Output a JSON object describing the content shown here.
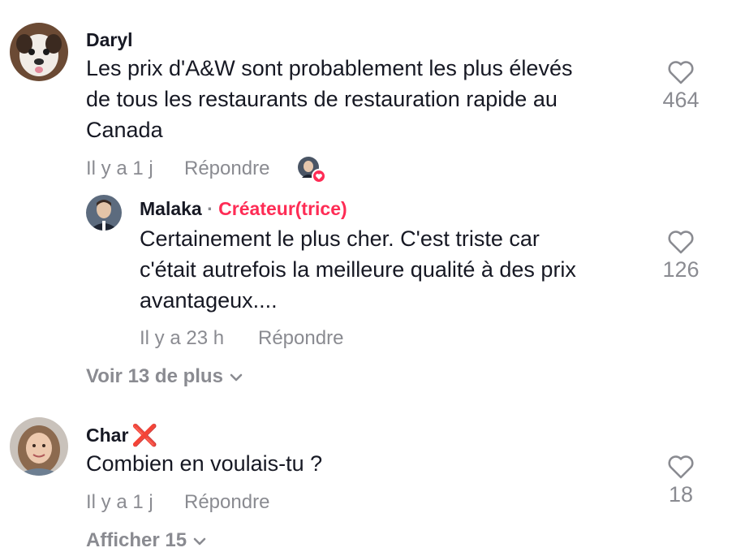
{
  "comments": [
    {
      "username": "Daryl",
      "text": "Les prix d'A&W sont probablement les plus élevés de tous les restaurants de restauration rapide au Canada",
      "lines": [
        "Les prix d'A&W sont probablement les plus élevés",
        "de tous les restaurants de restauration rapide au",
        "Canada"
      ],
      "time": "Il y a 1 j",
      "reply_label": "Répondre",
      "likes": "464",
      "creator_liked": true
    },
    {
      "username": "Malaka",
      "separator": "·",
      "creator_label": "Créateur(trice)",
      "text": "Certainement le plus cher. C'est triste car c'était autrefois la meilleure qualité à des prix avantageux....",
      "lines": [
        "Certainement le plus cher. C'est triste car",
        "c'était autrefois la meilleure qualité à des prix",
        "avantageux...."
      ],
      "time": "Il y a 23 h",
      "reply_label": "Répondre",
      "likes": "126"
    },
    {
      "username": "Char",
      "badge": "❌",
      "text": "Combien en voulais-tu ?",
      "lines": [
        "Combien en voulais-tu ?"
      ],
      "time": "Il y a 1 j",
      "reply_label": "Répondre",
      "likes": "18"
    }
  ],
  "view_more_replies": "Voir 13 de plus",
  "show_more_partial": "Afficher 15",
  "icons": {
    "like": "heart-outline-icon",
    "expand": "chevron-down-icon",
    "creator_like_badge": "heart-badge-icon"
  },
  "colors": {
    "creator_accent": "#fe2c55",
    "muted_text": "#8a8b91",
    "badge_red": "#e02a2a"
  }
}
